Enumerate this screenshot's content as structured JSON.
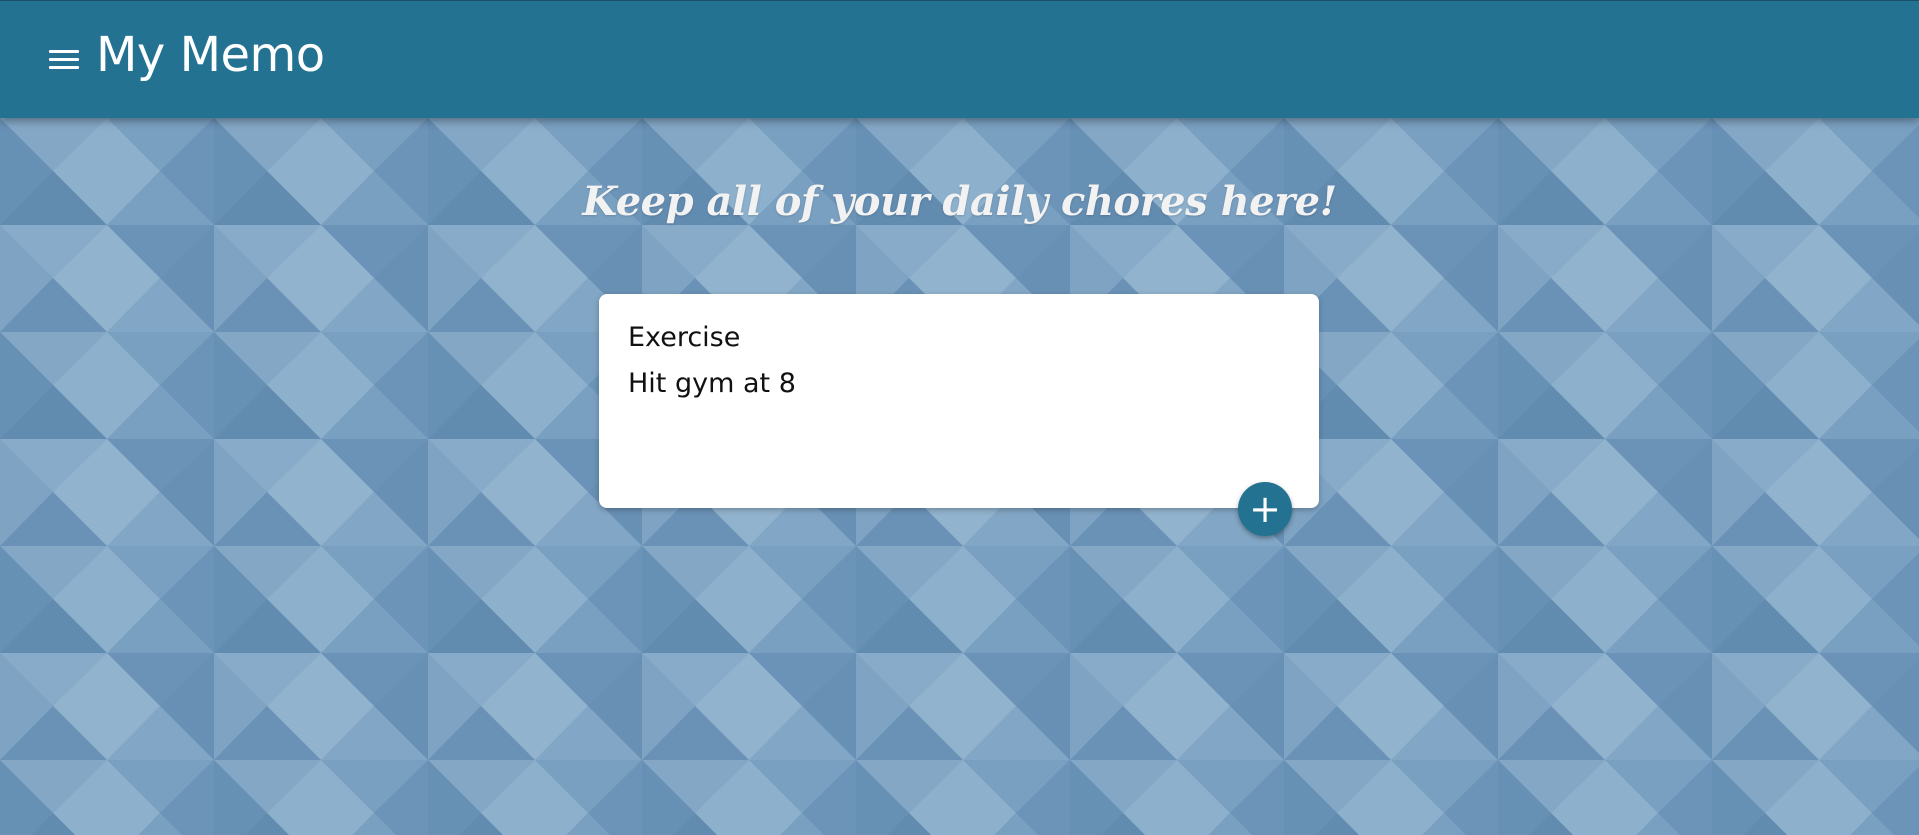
{
  "colors": {
    "app_bar": "#237291",
    "background": "#7299bb",
    "card": "#ffffff",
    "accent": "#237291"
  },
  "header": {
    "menu_icon": "hamburger-menu-icon",
    "title": "My Memo"
  },
  "main": {
    "tagline": "Keep all of your daily chores here!",
    "memo": {
      "title_value": "Exercise",
      "content_value": "Hit gym at 8",
      "add_button_label": "+",
      "add_icon": "plus-icon"
    }
  }
}
